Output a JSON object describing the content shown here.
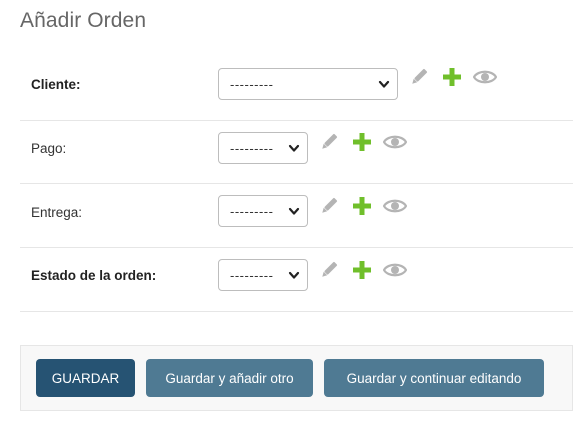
{
  "page": {
    "title": "Añadir Orden"
  },
  "colors": {
    "primary_button": "#265373",
    "secondary_button": "#4f7a93",
    "add_icon": "#70bf2b",
    "muted_icon": "#b4b4b4"
  },
  "fields": [
    {
      "label": "Cliente:",
      "required": true,
      "selected": "---------",
      "icons": [
        "pencil-icon",
        "plus-icon",
        "eye-icon"
      ]
    },
    {
      "label": "Pago:",
      "required": false,
      "selected": "---------",
      "icons": [
        "pencil-icon",
        "plus-icon",
        "eye-icon"
      ]
    },
    {
      "label": "Entrega:",
      "required": false,
      "selected": "---------",
      "icons": [
        "pencil-icon",
        "plus-icon",
        "eye-icon"
      ]
    },
    {
      "label": "Estado de la orden:",
      "required": true,
      "selected": "---------",
      "icons": [
        "pencil-icon",
        "plus-icon",
        "eye-icon"
      ]
    }
  ],
  "buttons": {
    "save": "GUARDAR",
    "save_add_another": "Guardar y añadir otro",
    "save_continue": "Guardar y continuar editando"
  }
}
